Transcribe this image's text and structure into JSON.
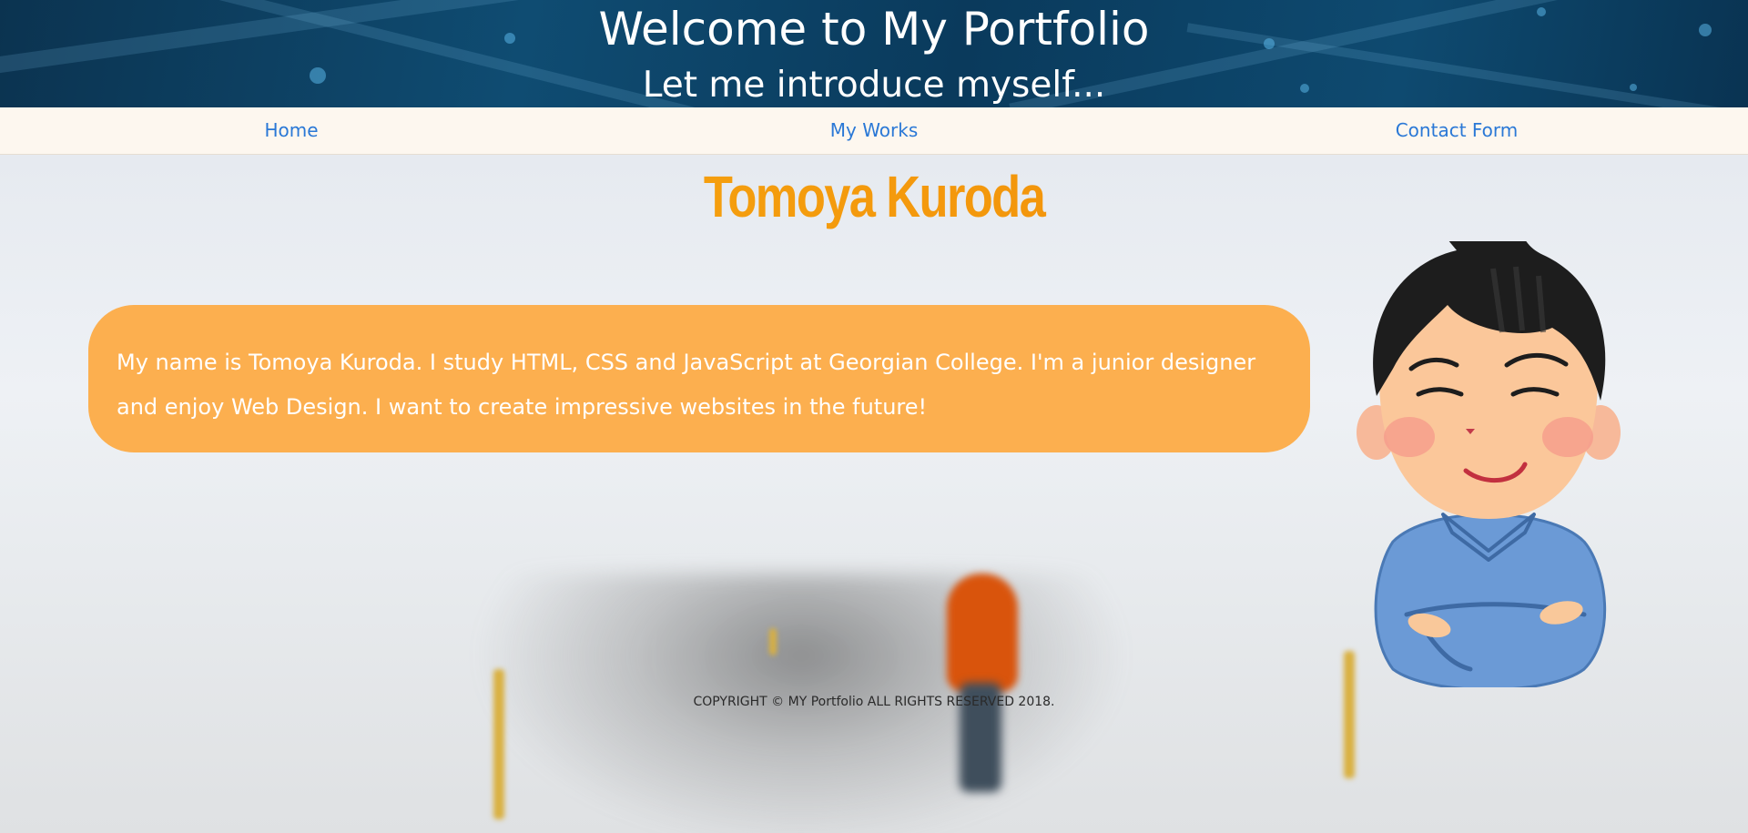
{
  "header": {
    "title": "Welcome to My Portfolio",
    "subtitle": "Let me introduce myself..."
  },
  "nav": {
    "items": [
      {
        "label": "Home"
      },
      {
        "label": "My Works"
      },
      {
        "label": "Contact Form"
      }
    ]
  },
  "main": {
    "name": "Tomoya Kuroda",
    "intro": "My name is Tomoya Kuroda. I study HTML, CSS and JavaScript at Georgian College. I'm a junior designer and enjoy Web Design. I want to create impressive websites in the future!",
    "avatar_icon": "cartoon-person-arms-crossed"
  },
  "footer": {
    "copyright": "COPYRIGHT © MY Portfolio ALL RIGHTS RESERVED 2018."
  },
  "colors": {
    "accent_orange": "#fcaf4f",
    "name_gradient_start": "#f7ab11",
    "name_gradient_end": "#ef8a0a",
    "nav_link": "#2a78d6",
    "nav_background": "#fdf7ef",
    "header_background": "#0f4c72"
  }
}
